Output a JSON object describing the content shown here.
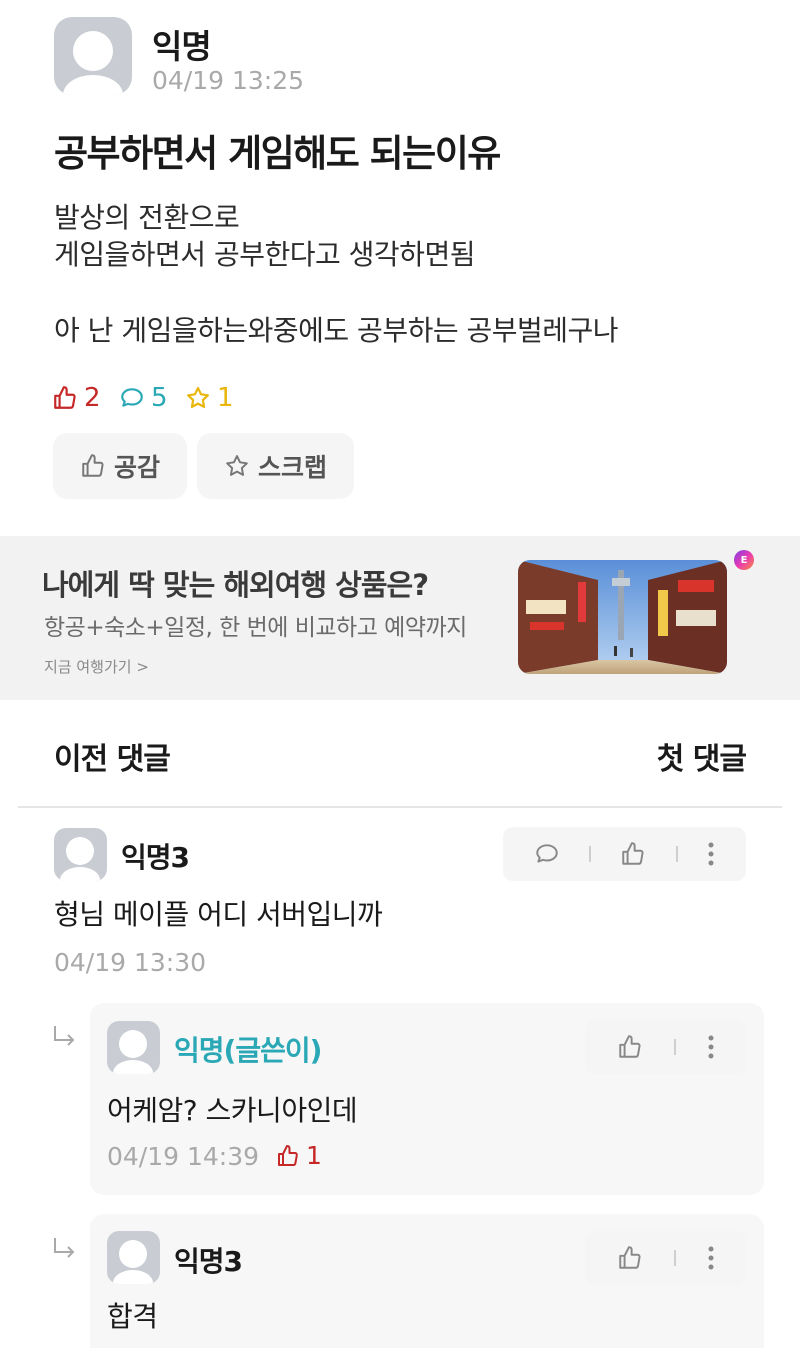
{
  "post": {
    "author": "익명",
    "time": "04/19 13:25",
    "title": "공부하면서 게임해도 되는이유",
    "body": [
      "발상의 전환으로",
      "게임을하면서 공부한다고 생각하면됨",
      "아 난 게임을하는와중에도 공부하는 공부벌레구나"
    ],
    "stats": {
      "likes": "2",
      "comments": "5",
      "scraps": "1"
    },
    "actions": {
      "like_label": "공감",
      "scrap_label": "스크랩"
    }
  },
  "ad": {
    "title": "나에게 딱 맞는 해외여행 상품은?",
    "subtitle": "항공+숙소+일정, 한 번에 비교하고 예약까지",
    "link": "지금 여행가기 >",
    "badge": "E"
  },
  "comments_nav": {
    "prev": "이전 댓글",
    "first": "첫 댓글"
  },
  "comments": [
    {
      "author": "익명3",
      "text": "형님 메이플 어디 서버입니까",
      "time": "04/19 13:30"
    }
  ],
  "replies": [
    {
      "author": "익명(글쓴이)",
      "text": "어케암? 스카니아인데",
      "time": "04/19 14:39",
      "likes": "1"
    },
    {
      "author": "익명3",
      "text": "합격"
    }
  ],
  "colors": {
    "like": "#c62828",
    "comment": "#2aa8b5",
    "scrap": "#e9b60b",
    "writer": "#2aa8b5"
  }
}
